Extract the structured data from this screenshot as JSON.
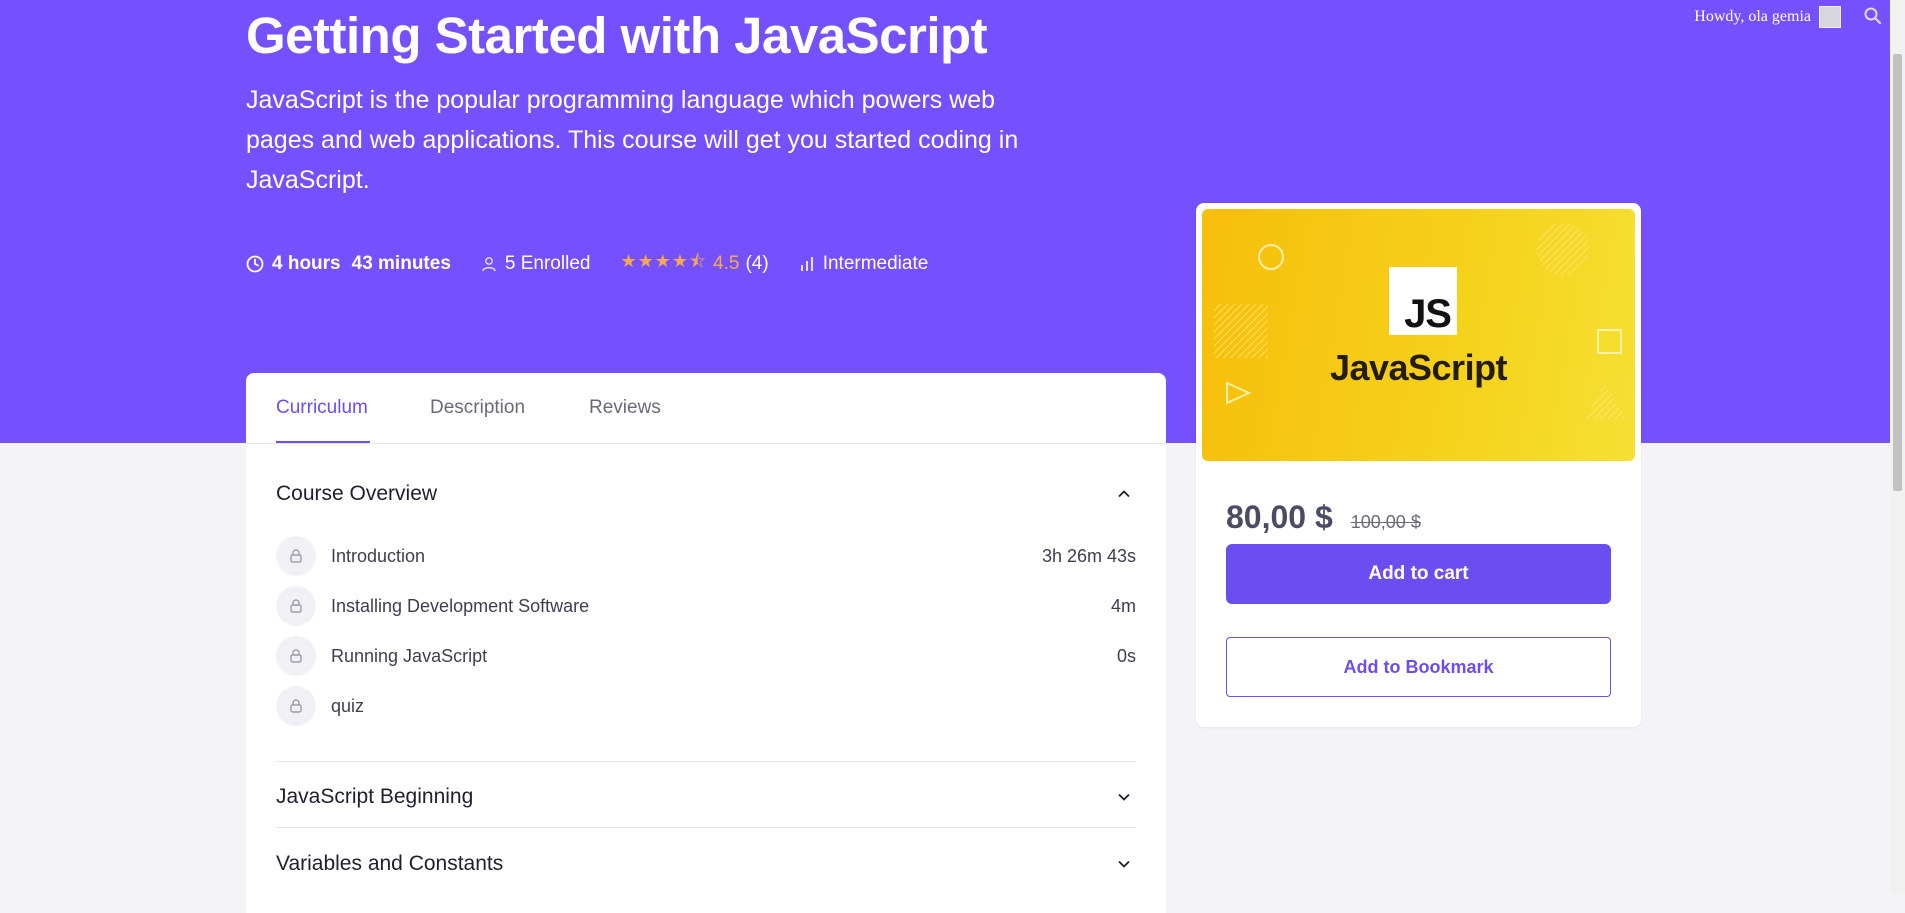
{
  "topbar": {
    "greeting": "Howdy, ola gemia",
    "avatar_icon": "avatar-placeholder",
    "search_icon": "search-icon"
  },
  "course": {
    "title": "Getting Started with JavaScript",
    "description": "JavaScript is the popular programming language which powers web pages and web applications. This course will get you started coding in JavaScript.",
    "meta": {
      "duration_hours": "4 hours",
      "duration_minutes": "43 minutes",
      "enrolled": "5 Enrolled",
      "rating_value": "4.5",
      "rating_count": "(4)",
      "rating_stars": 4.5,
      "level": "Intermediate"
    }
  },
  "tabs": [
    {
      "label": "Curriculum",
      "active": true
    },
    {
      "label": "Description",
      "active": false
    },
    {
      "label": "Reviews",
      "active": false
    }
  ],
  "curriculum": {
    "sections": [
      {
        "title": "Course Overview",
        "expanded": true,
        "lessons": [
          {
            "title": "Introduction",
            "duration": "3h 26m 43s",
            "locked": true
          },
          {
            "title": "Installing Development Software",
            "duration": "4m",
            "locked": true
          },
          {
            "title": "Running JavaScript",
            "duration": "0s",
            "locked": true
          },
          {
            "title": "quiz",
            "duration": "",
            "locked": true
          }
        ]
      },
      {
        "title": "JavaScript Beginning",
        "expanded": false
      },
      {
        "title": "Variables and Constants",
        "expanded": false
      }
    ]
  },
  "sidebar": {
    "thumbnail": {
      "logo_text": "JS",
      "title": "JavaScript"
    },
    "price": "80,00 $",
    "old_price": "100,00 $",
    "add_to_cart": "Add to cart",
    "add_to_bookmark": "Add to Bookmark"
  },
  "colors": {
    "brand": "#7551fe",
    "accent": "#6b4ef0",
    "star": "#f8a84e",
    "thumbnail": "#f7c80f"
  }
}
